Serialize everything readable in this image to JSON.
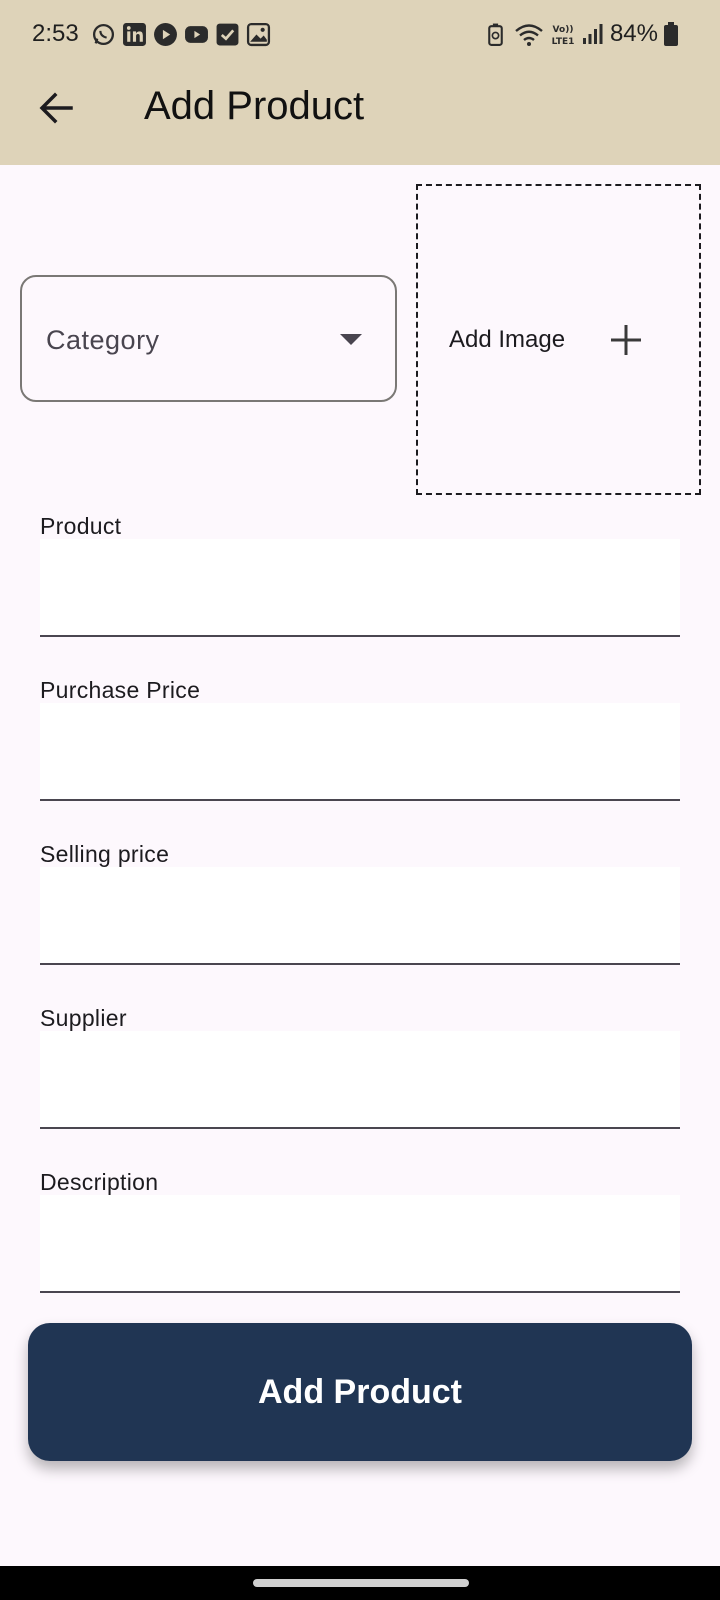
{
  "status_bar": {
    "time": "2:53",
    "battery": "84%",
    "network": "Vo)) LTE1",
    "left_icons": [
      "whatsapp-icon",
      "linkedin-icon",
      "play-icon",
      "youtube-icon",
      "checkbox-icon",
      "gallery-icon"
    ],
    "right_icons": [
      "battery-saver-icon",
      "wifi-icon",
      "lte-icon",
      "signal-icon",
      "battery-icon"
    ]
  },
  "header": {
    "title": "Add Product",
    "back_icon": "arrow-back-icon",
    "background": "#ded3b9"
  },
  "form": {
    "category": {
      "label": "Category",
      "icon": "dropdown-caret-icon"
    },
    "image": {
      "label": "Add Image",
      "icon": "plus-icon"
    },
    "fields": [
      {
        "label": "Product",
        "value": ""
      },
      {
        "label": "Purchase Price",
        "value": ""
      },
      {
        "label": "Selling price",
        "value": ""
      },
      {
        "label": "Supplier",
        "value": ""
      },
      {
        "label": "Description",
        "value": ""
      }
    ],
    "submit_label": "Add Product",
    "submit_color": "#203553"
  }
}
